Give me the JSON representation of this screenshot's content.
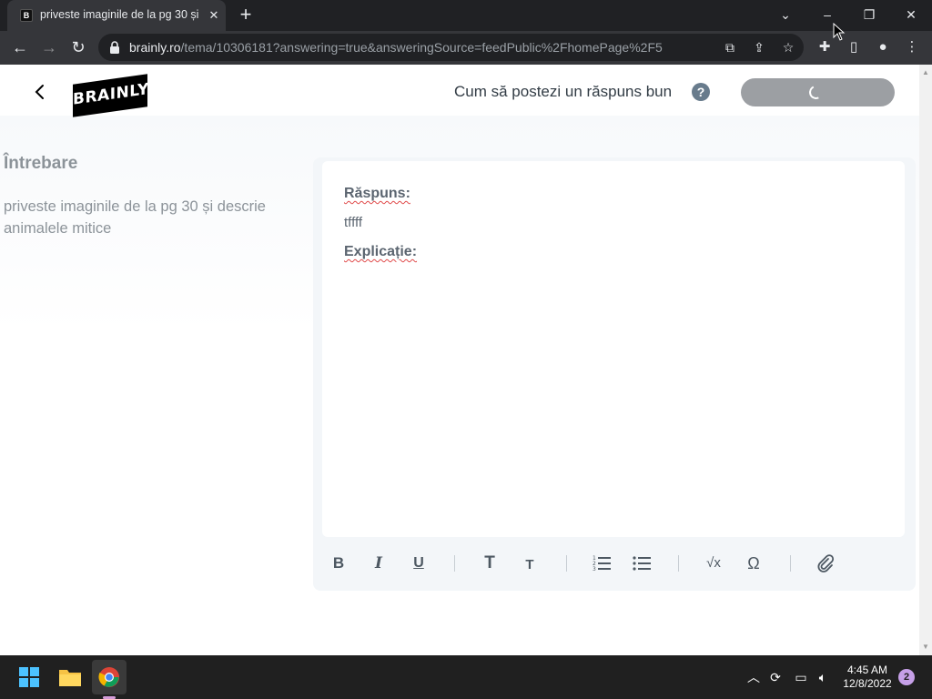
{
  "browser": {
    "tab_title": "priveste imaginile de la pg 30 și descrie animalele mitice",
    "tab_favicon": "B",
    "url_host": "brainly.ro",
    "url_path": "/tema/10306181?answering=true&answeringSource=feedPublic%2FhomePage%2F5",
    "icons": [
      "back-icon",
      "forward-icon",
      "reload-icon",
      "lock-icon",
      "translate-icon",
      "share-icon",
      "bookmark-star-icon",
      "extensions-icon",
      "side-panel-icon",
      "profile-icon",
      "menu-icon"
    ]
  },
  "header": {
    "logo_text": "BRAINLY",
    "how_to_label": "Cum să postezi un răspuns bun",
    "help_icon": "?"
  },
  "question": {
    "heading": "Întrebare",
    "text": "priveste imaginile de la pg 30 și descrie animalele mitice"
  },
  "editor": {
    "answer_label": "Răspuns:",
    "answer_text": "tffff",
    "explanation_label": "Explicație:",
    "toolbar": {
      "bold": "B",
      "italic": "I",
      "underline": "U",
      "heading": "T",
      "subheading": "T",
      "omega": "Ω",
      "sqrt": "√x"
    }
  },
  "taskbar": {
    "time": "4:45 AM",
    "date": "12/8/2022",
    "notification_count": "2",
    "apps": [
      "windows-start-icon",
      "file-explorer-icon",
      "chrome-icon"
    ]
  },
  "colors": {
    "submit_button": "#9c9fa3",
    "brainly_black": "#000000",
    "chrome_dark": "#202124"
  }
}
